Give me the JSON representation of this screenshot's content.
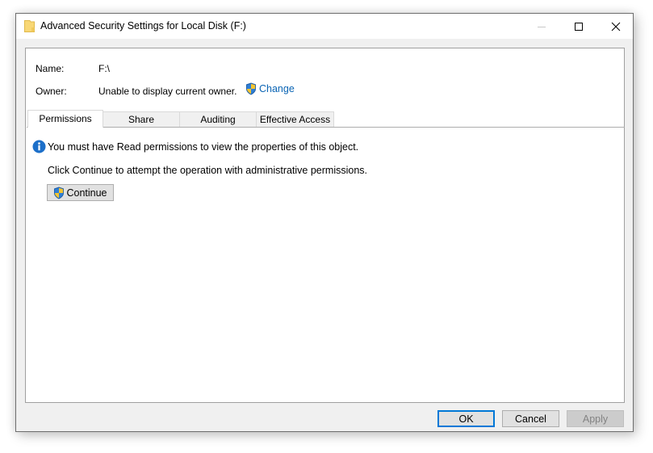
{
  "window": {
    "title": "Advanced Security Settings for Local Disk (F:)",
    "title_icon": "folder-icon",
    "controls": [
      "minimize-icon",
      "maximize-icon",
      "close-icon"
    ]
  },
  "header": {
    "name_label": "Name:",
    "name_value": "F:\\",
    "owner_label": "Owner:",
    "owner_value": "Unable to display current owner.",
    "change_link": "Change",
    "change_icon": "uac-shield-icon"
  },
  "tabs": [
    {
      "label": "Permissions",
      "active": true
    },
    {
      "label": "Share",
      "active": false
    },
    {
      "label": "Auditing",
      "active": false
    },
    {
      "label": "Effective Access",
      "active": false
    }
  ],
  "content": {
    "info_icon": "info-icon",
    "info_message": "You must have Read permissions to view the properties of this object.",
    "instruction": "Click Continue to attempt the operation with administrative permissions.",
    "continue_label": "Continue"
  },
  "footer": {
    "ok_label": "OK",
    "cancel_label": "Cancel",
    "apply_label": "Apply",
    "apply_disabled": true
  },
  "colors": {
    "link": "#0a64b4",
    "default_button_border": "#0078d7",
    "info_blue": "#1c6fc9"
  }
}
